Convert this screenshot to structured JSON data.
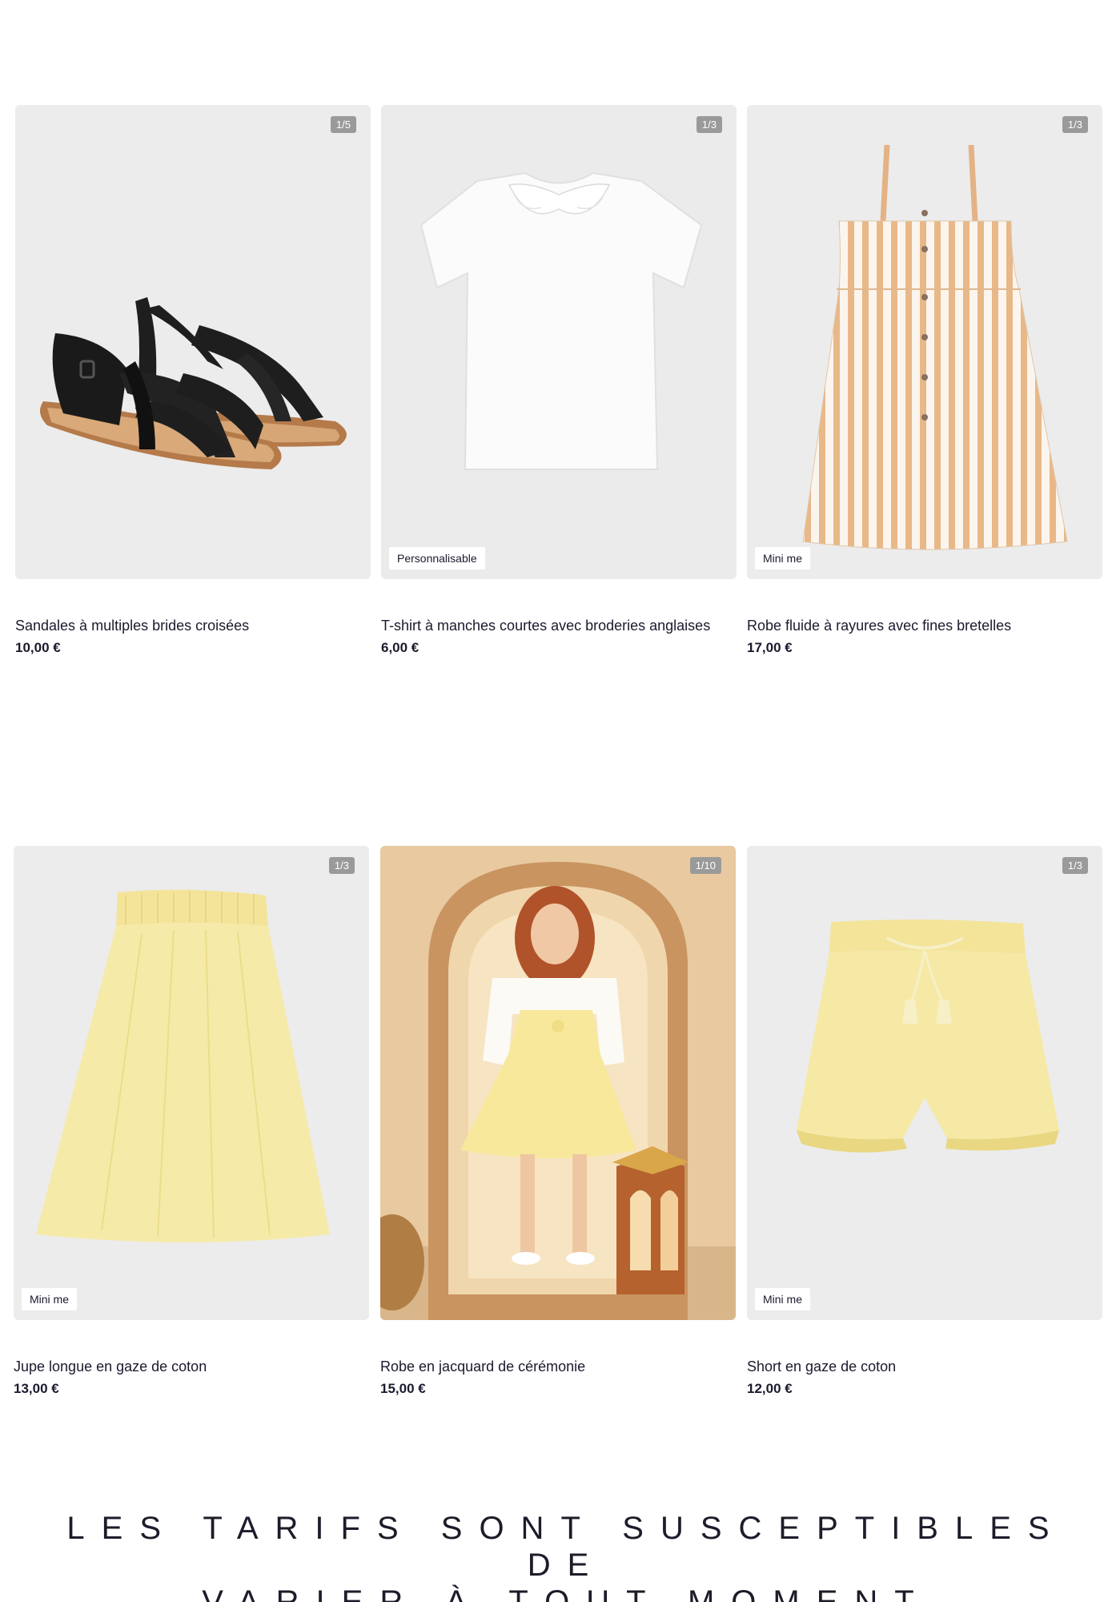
{
  "products": [
    {
      "title": "Sandales à multiples brides croisées",
      "price": "10,00 €",
      "counter": "1/5",
      "tag": "",
      "icon": "sandals-image"
    },
    {
      "title": "T-shirt à manches courtes avec broderies anglaises",
      "price": "6,00 €",
      "counter": "1/3",
      "tag": "Personnalisable",
      "icon": "tshirt-image"
    },
    {
      "title": "Robe fluide à rayures avec fines bretelles",
      "price": "17,00 €",
      "counter": "1/3",
      "tag": "Mini me",
      "icon": "striped-dress-image"
    },
    {
      "title": "Jupe longue en gaze de coton",
      "price": "13,00 €",
      "counter": "1/3",
      "tag": "Mini me",
      "icon": "skirt-image"
    },
    {
      "title": "Robe en jacquard de cérémonie",
      "price": "15,00 €",
      "counter": "1/10",
      "tag": "",
      "icon": "ceremony-dress-photo"
    },
    {
      "title": "Short en gaze de coton",
      "price": "12,00 €",
      "counter": "1/3",
      "tag": "Mini me",
      "icon": "shorts-image"
    }
  ],
  "disclaimer": {
    "line1": "LES TARIFS SONT SUSCEPTIBLES DE",
    "line2": "VARIER À TOUT MOMENT"
  },
  "colors": {
    "text": "#1a1a2e",
    "image_bg": "#efefef",
    "counter_bg": "#9a9a9a",
    "yellow": "#f5e89a",
    "black_leather": "#1e1e1e"
  }
}
